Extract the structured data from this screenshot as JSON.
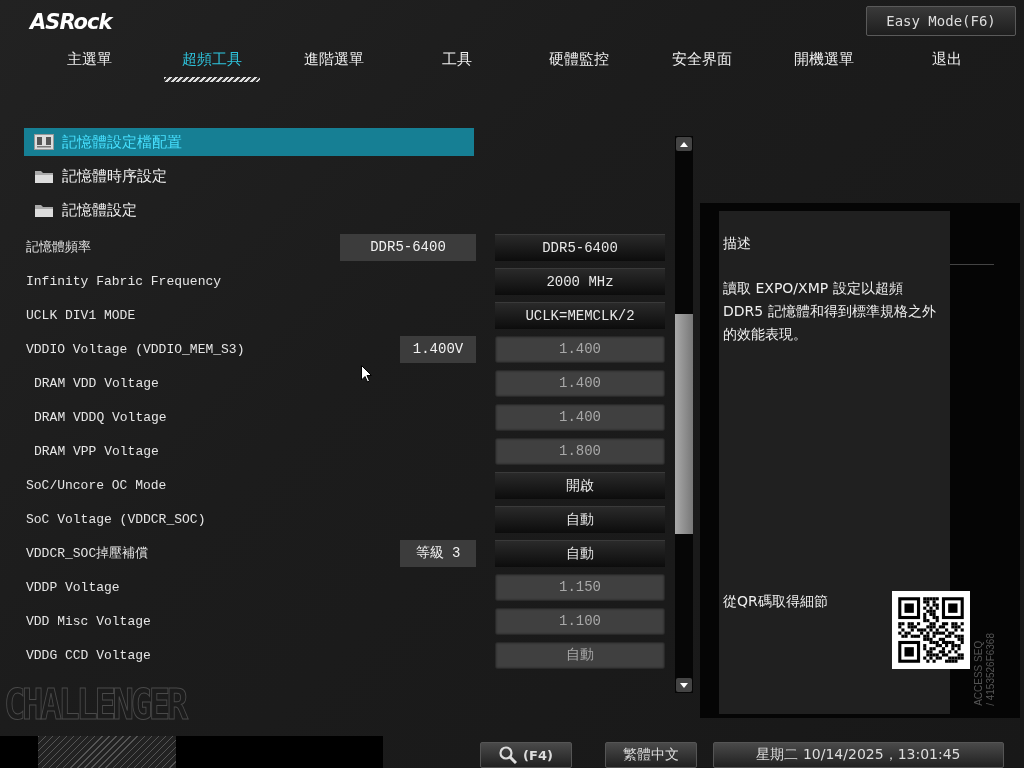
{
  "logo": "ASRock",
  "easy_mode_button": "Easy Mode(F6)",
  "tabs": [
    {
      "label": "主選單",
      "selected": false
    },
    {
      "label": "超頻工具",
      "selected": true
    },
    {
      "label": "進階選單",
      "selected": false
    },
    {
      "label": "工具",
      "selected": false
    },
    {
      "label": "硬體監控",
      "selected": false
    },
    {
      "label": "安全界面",
      "selected": false
    },
    {
      "label": "開機選單",
      "selected": false
    },
    {
      "label": "退出",
      "selected": false
    }
  ],
  "menu_items": [
    {
      "label": "記憶體設定檔配置",
      "kind": "profile",
      "selected": true
    },
    {
      "label": "記憶體時序設定",
      "kind": "folder",
      "selected": false
    },
    {
      "label": "記憶體設定",
      "kind": "folder",
      "selected": false
    }
  ],
  "settings": [
    {
      "label": "記憶體頻率",
      "current": "DDR5-6400",
      "value": "DDR5-6400",
      "kind": "option"
    },
    {
      "label": "Infinity Fabric Frequency",
      "value": "2000 MHz",
      "kind": "option"
    },
    {
      "label": "UCLK DIV1 MODE",
      "value": "UCLK=MEMCLK/2",
      "kind": "option"
    },
    {
      "label": "VDDIO Voltage (VDDIO_MEM_S3)",
      "current": "1.400V",
      "value": "1.400",
      "kind": "number",
      "children": [
        {
          "label": "DRAM VDD Voltage",
          "value": "1.400",
          "kind": "number"
        },
        {
          "label": "DRAM VDDQ Voltage",
          "value": "1.400",
          "kind": "number"
        },
        {
          "label": "DRAM VPP Voltage",
          "value": "1.800",
          "kind": "number"
        }
      ]
    },
    {
      "label": "SoC/Uncore OC Mode",
      "value": "開啟",
      "kind": "option"
    },
    {
      "label": "SoC Voltage (VDDCR_SOC)",
      "value": "自動",
      "kind": "option"
    },
    {
      "label": "VDDCR_SOC掉壓補償",
      "current": "等級 3",
      "value": "自動",
      "kind": "option"
    },
    {
      "label": "VDDP Voltage",
      "value": "1.150",
      "kind": "number"
    },
    {
      "label": "VDD Misc Voltage",
      "value": "1.100",
      "kind": "number"
    },
    {
      "label": "VDDG CCD Voltage",
      "value": "自動",
      "kind": "number"
    }
  ],
  "help": {
    "title": "描述",
    "text": "讀取 EXPO/XMP 設定以超頻 DDR5 記憶體和得到標準規格之外的效能表現。",
    "qr_caption": "從QR碼取得細節",
    "access_label": "ACCESS SEQ",
    "access_code": "/ 4153526F6368"
  },
  "brand": "CHALLENGER",
  "footer": {
    "search_key": "(F4)",
    "language": "繁體中文",
    "datetime": "星期二 10/14/2025，13:01:45"
  }
}
